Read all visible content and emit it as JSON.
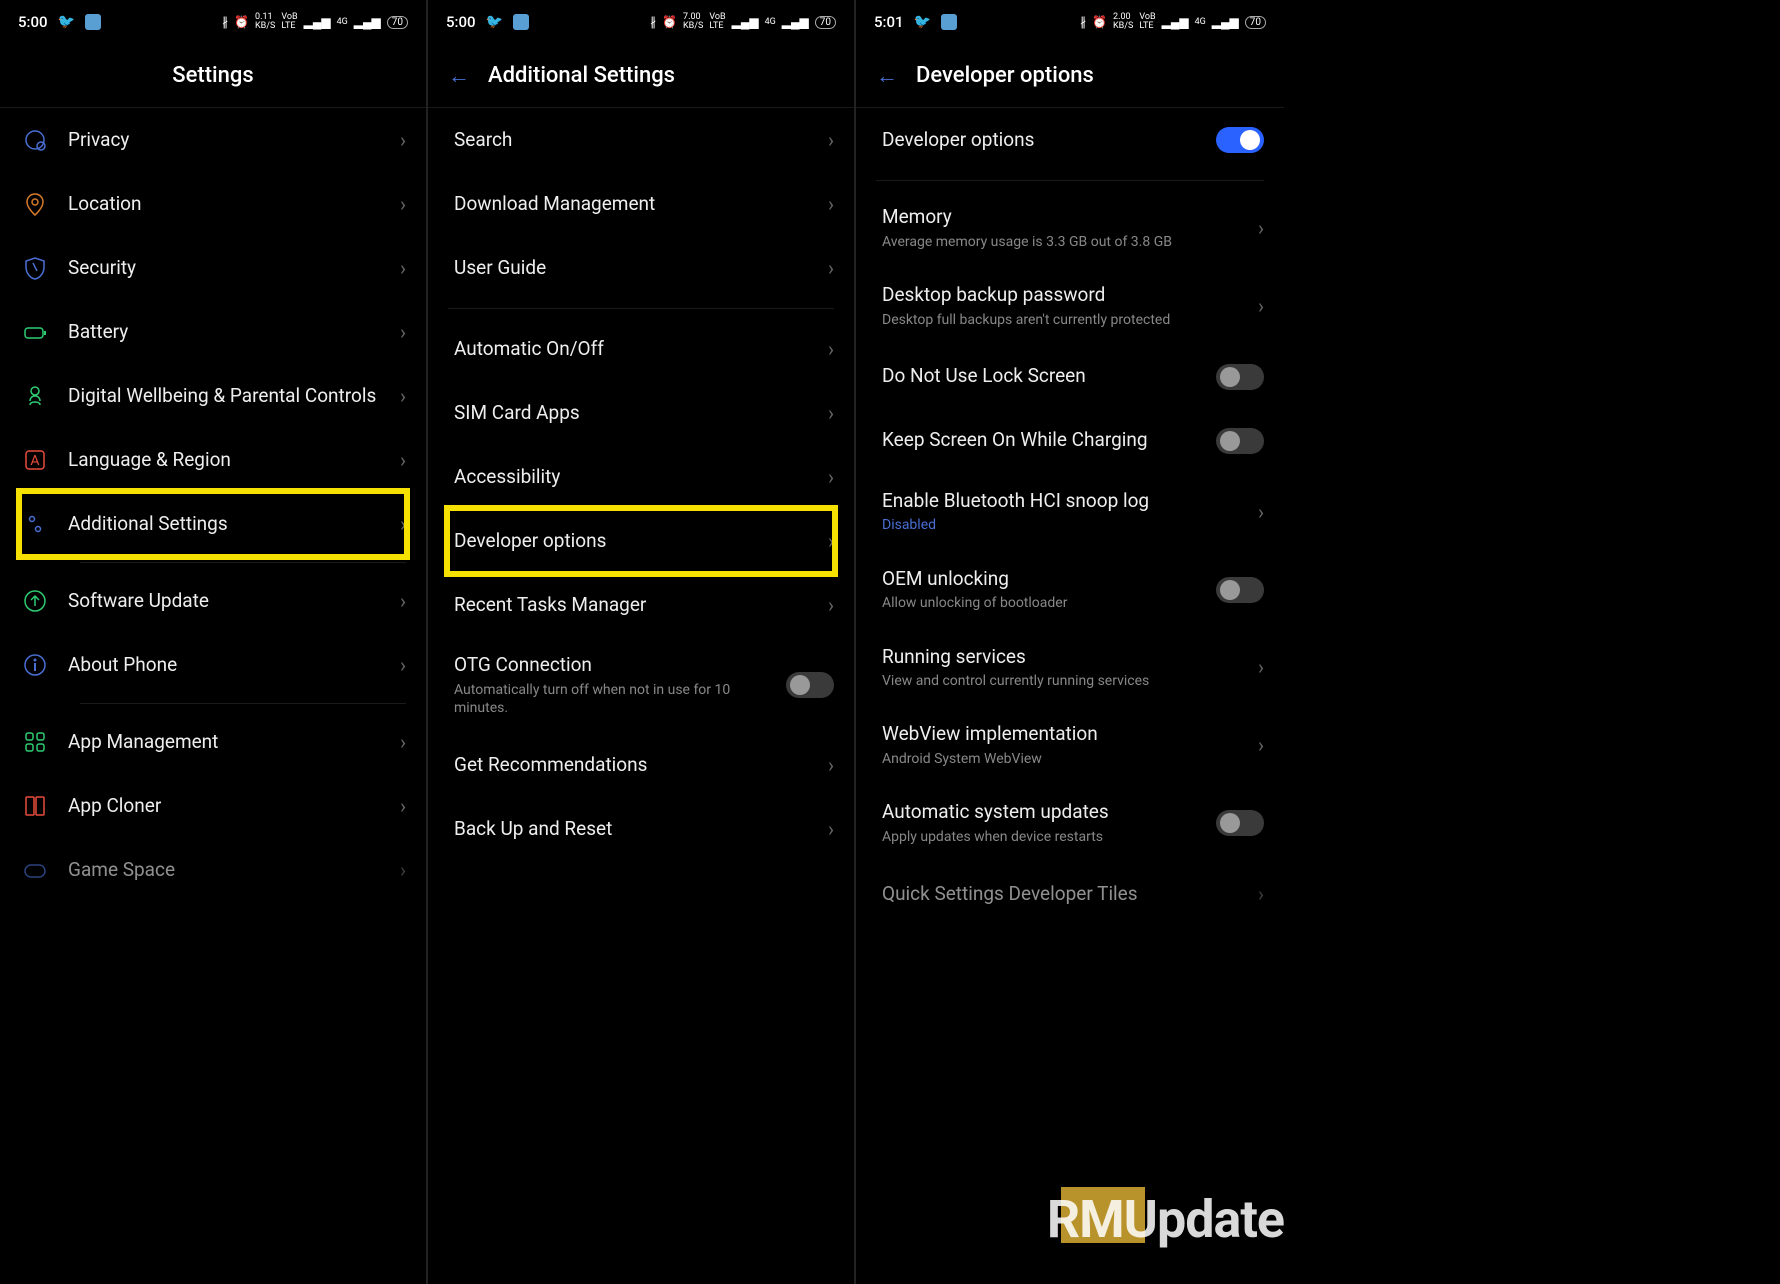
{
  "watermark": "RMUpdate",
  "panels": [
    {
      "status": {
        "time": "5:00",
        "kbps": "0.11",
        "net": "4G",
        "battery": "70"
      },
      "title": "Settings",
      "hasBack": false,
      "items": [
        {
          "icon": "privacy",
          "label": "Privacy",
          "ctrl": "chevron"
        },
        {
          "icon": "location",
          "label": "Location",
          "ctrl": "chevron"
        },
        {
          "icon": "security",
          "label": "Security",
          "ctrl": "chevron"
        },
        {
          "icon": "battery",
          "label": "Battery",
          "ctrl": "chevron"
        },
        {
          "icon": "wellbeing",
          "label": "Digital Wellbeing & Parental Controls",
          "ctrl": "chevron"
        },
        {
          "icon": "language",
          "label": "Language & Region",
          "ctrl": "chevron"
        },
        {
          "icon": "additional",
          "label": "Additional Settings",
          "ctrl": "chevron",
          "highlight": true
        },
        {
          "divider": true
        },
        {
          "icon": "update",
          "label": "Software Update",
          "ctrl": "chevron"
        },
        {
          "icon": "about",
          "label": "About Phone",
          "ctrl": "chevron"
        },
        {
          "divider": true
        },
        {
          "icon": "appmgmt",
          "label": "App Management",
          "ctrl": "chevron"
        },
        {
          "icon": "cloner",
          "label": "App Cloner",
          "ctrl": "chevron"
        },
        {
          "icon": "gamespace",
          "label": "Game Space",
          "ctrl": "chevron",
          "cut": true
        }
      ]
    },
    {
      "status": {
        "time": "5:00",
        "kbps": "7.00",
        "net": "4G",
        "battery": "70"
      },
      "title": "Additional Settings",
      "hasBack": true,
      "items": [
        {
          "label": "Search",
          "ctrl": "chevron"
        },
        {
          "label": "Download Management",
          "ctrl": "chevron"
        },
        {
          "label": "User Guide",
          "ctrl": "chevron"
        },
        {
          "divider": true
        },
        {
          "label": "Automatic On/Off",
          "ctrl": "chevron"
        },
        {
          "label": "SIM Card Apps",
          "ctrl": "chevron"
        },
        {
          "label": "Accessibility",
          "ctrl": "chevron"
        },
        {
          "label": "Developer options",
          "ctrl": "chevron",
          "highlight": true
        },
        {
          "label": "Recent Tasks Manager",
          "ctrl": "chevron"
        },
        {
          "label": "OTG Connection",
          "sub": "Automatically turn off when not in use for 10 minutes.",
          "ctrl": "toggle-off"
        },
        {
          "label": "Get Recommendations",
          "ctrl": "chevron"
        },
        {
          "label": "Back Up and Reset",
          "ctrl": "chevron"
        }
      ]
    },
    {
      "status": {
        "time": "5:01",
        "kbps": "2.00",
        "net": "4G",
        "battery": "70"
      },
      "title": "Developer options",
      "hasBack": true,
      "items": [
        {
          "label": "Developer options",
          "ctrl": "toggle-on"
        },
        {
          "divider": true
        },
        {
          "label": "Memory",
          "sub": "Average memory usage is 3.3 GB out of 3.8 GB",
          "ctrl": "chevron"
        },
        {
          "label": "Desktop backup password",
          "sub": "Desktop full backups aren't currently protected",
          "ctrl": "chevron"
        },
        {
          "label": "Do Not Use Lock Screen",
          "ctrl": "toggle-off"
        },
        {
          "label": "Keep Screen On While Charging",
          "ctrl": "toggle-off"
        },
        {
          "label": "Enable Bluetooth HCI snoop log",
          "sub": "Disabled",
          "subClass": "blue",
          "ctrl": "chevron"
        },
        {
          "label": "OEM unlocking",
          "sub": "Allow unlocking of bootloader",
          "ctrl": "toggle-off"
        },
        {
          "label": "Running services",
          "sub": "View and control currently running services",
          "ctrl": "chevron"
        },
        {
          "label": "WebView implementation",
          "sub": "Android System WebView",
          "ctrl": "chevron"
        },
        {
          "label": "Automatic system updates",
          "sub": "Apply updates when device restarts",
          "ctrl": "toggle-off"
        },
        {
          "label": "Quick Settings Developer Tiles",
          "ctrl": "chevron",
          "cut": true
        }
      ]
    }
  ],
  "icons": {
    "privacy": {
      "color": "#4a6fd4"
    },
    "location": {
      "color": "#d47a2a"
    },
    "security": {
      "color": "#4a6fd4"
    },
    "battery": {
      "color": "#2ecc71"
    },
    "wellbeing": {
      "color": "#2ecc71"
    },
    "language": {
      "color": "#e74c3c"
    },
    "additional": {
      "color": "#4a6fd4"
    },
    "update": {
      "color": "#2ecc71"
    },
    "about": {
      "color": "#4a6fd4"
    },
    "appmgmt": {
      "color": "#2ecc71"
    },
    "cloner": {
      "color": "#e74c3c"
    },
    "gamespace": {
      "color": "#4a6fd4"
    }
  }
}
